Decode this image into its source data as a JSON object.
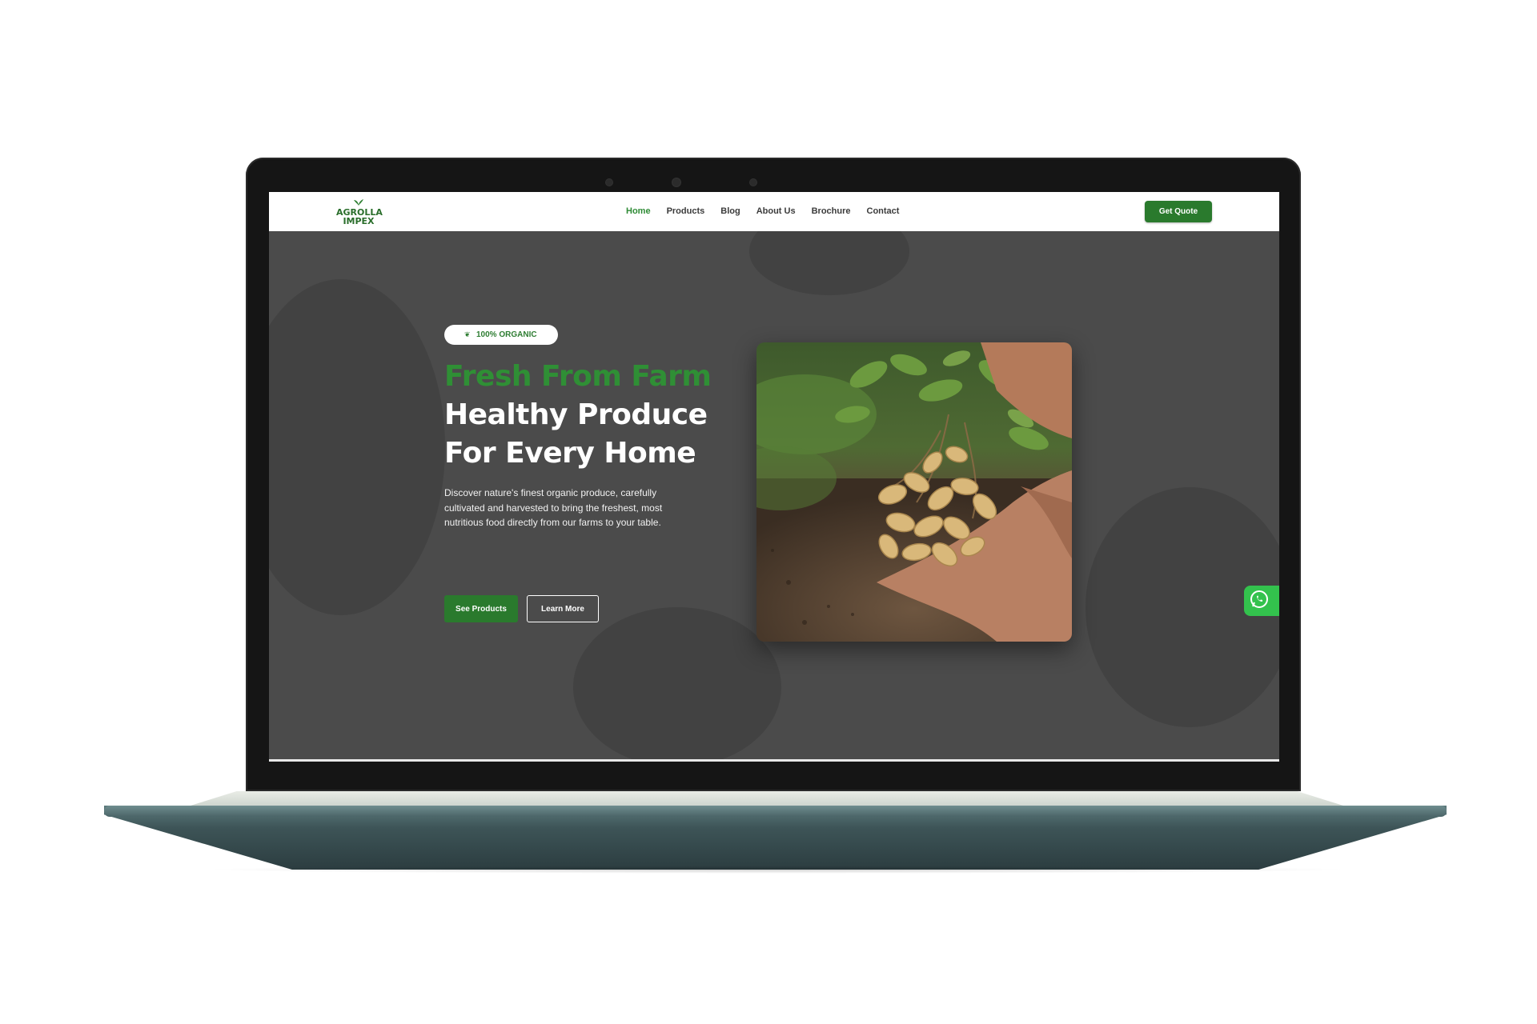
{
  "brand": {
    "logo_line1": "AGROLLA",
    "logo_line2": "IMPEX",
    "primary_color": "#2a7a2d",
    "accent_green": "#2f8f35"
  },
  "nav": {
    "items": [
      {
        "label": "Home",
        "active": true
      },
      {
        "label": "Products",
        "active": false
      },
      {
        "label": "Blog",
        "active": false
      },
      {
        "label": "About Us",
        "active": false
      },
      {
        "label": "Brochure",
        "active": false
      },
      {
        "label": "Contact",
        "active": false
      }
    ],
    "cta_label": "Get Quote"
  },
  "hero": {
    "badge": "100% ORGANIC",
    "headline_green": "Fresh From Farm",
    "headline_line2": "Healthy Produce",
    "headline_line3": "For Every Home",
    "description": "Discover nature's finest organic produce, carefully cultivated and harvested to bring the freshest, most nutritious food directly from our farms to your table.",
    "primary_button": "See Products",
    "secondary_button": "Learn More",
    "image_subject": "hands-holding-peanut-plant"
  },
  "floating": {
    "whatsapp_icon": "whatsapp-icon"
  }
}
